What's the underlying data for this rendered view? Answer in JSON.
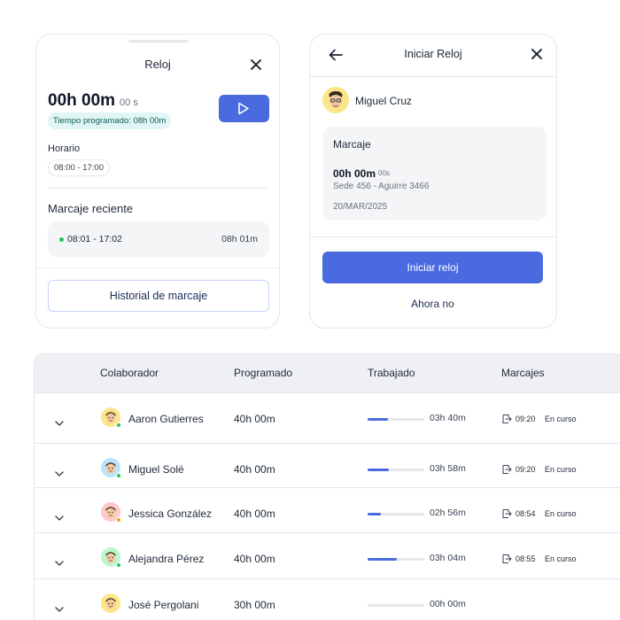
{
  "reloj_card": {
    "title": "Reloj",
    "timer_main": "00h 00m",
    "timer_seconds": "00 s",
    "scheduled_time": "Tiempo programado: 08h 00m",
    "horario_label": "Horario",
    "horario_value": "08:00 - 17:00",
    "recent_label": "Marcaje reciente",
    "recent_times": "08:01 - 17:02",
    "recent_duration": "08h 01m",
    "history_button": "Historial de marcaje",
    "icons": [
      "close-icon",
      "play-icon"
    ],
    "colors": {
      "primary": "#4a6be0",
      "pill_bg": "#e0f5f4",
      "active_dot": "#22c55e"
    }
  },
  "iniciar_card": {
    "title": "Iniciar Reloj",
    "user_name": "Miguel Cruz",
    "marcaje_title": "Marcaje",
    "marcaje_time": "00h 00m",
    "marcaje_seconds": "00s",
    "location": "Sede 456 - Aguirre 3466",
    "date": "20/MAR/2025",
    "start_button": "Iniciar reloj",
    "later_button": "Ahora no",
    "icons": [
      "back-arrow-icon",
      "close-icon"
    ]
  },
  "table": {
    "headers": {
      "colaborador": "Colaborador",
      "programado": "Programado",
      "trabajado": "Trabajado",
      "marcajes": "Marcajes"
    },
    "rows": [
      {
        "name": "Aaron Gutierres",
        "programado": "40h 00m",
        "trabajado": "03h 40m",
        "progress": 0.36,
        "marcaje_time": "09:20",
        "marcaje_status": "En curso",
        "status_color": "#22c55e",
        "avatar_bg": "#fde68a"
      },
      {
        "name": "Miguel Solé",
        "programado": "40h 00m",
        "trabajado": "03h 58m",
        "progress": 0.37,
        "marcaje_time": "09:20",
        "marcaje_status": "En curso",
        "status_color": "#22c55e",
        "avatar_bg": "#bae6fd"
      },
      {
        "name": "Jessica González",
        "programado": "40h 00m",
        "trabajado": "02h 56m",
        "progress": 0.24,
        "marcaje_time": "08:54",
        "marcaje_status": "En curso",
        "status_color": "#f59e0b",
        "avatar_bg": "#fecaca"
      },
      {
        "name": "Alejandra Pérez",
        "programado": "40h 00m",
        "trabajado": "03h 04m",
        "progress": 0.51,
        "marcaje_time": "08:55",
        "marcaje_status": "En curso",
        "status_color": "#22c55e",
        "avatar_bg": "#bbf7d0"
      },
      {
        "name": "José Pergolani",
        "programado": "30h 00m",
        "trabajado": "00h 00m",
        "progress": 0,
        "marcaje_time": "",
        "marcaje_status": "",
        "status_color": "",
        "avatar_bg": "#fde68a"
      }
    ],
    "icons": [
      "chevron-down-icon",
      "clock-in-icon"
    ]
  }
}
